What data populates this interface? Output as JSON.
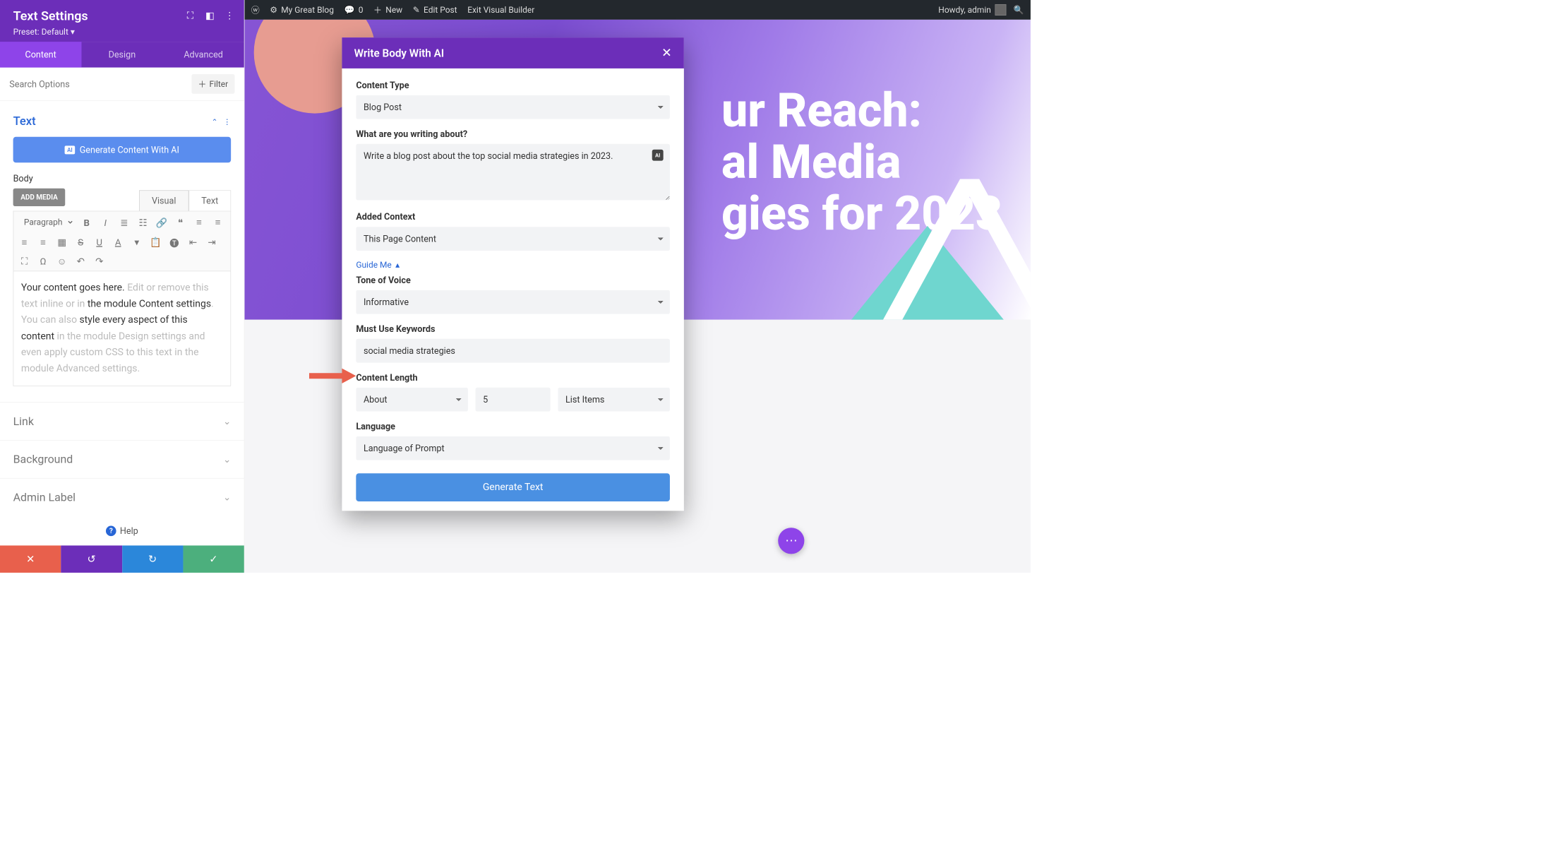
{
  "sidebar": {
    "title": "Text Settings",
    "preset": "Preset: Default",
    "tabs": [
      "Content",
      "Design",
      "Advanced"
    ],
    "active_tab": 0,
    "search_placeholder": "Search Options",
    "filter_label": "Filter",
    "section_title": "Text",
    "generate_btn": "Generate Content With AI",
    "body_label": "Body",
    "add_media": "ADD MEDIA",
    "editor_tabs": [
      "Visual",
      "Text"
    ],
    "active_editor_tab": 0,
    "paragraph_sel": "Paragraph",
    "editor_text_a": "Your content goes here.",
    "editor_text_b": " Edit or remove this text inline or in ",
    "editor_text_c": "the module Content settings",
    "editor_text_d": ". You can also ",
    "editor_text_e": "style every aspect of this content ",
    "editor_text_f": "in the module Design settings and even apply custom CSS to this text in the module Advanced settings.",
    "rows": [
      "Link",
      "Background",
      "Admin Label"
    ],
    "help": "Help"
  },
  "adminbar": {
    "site": "My Great Blog",
    "comments": "0",
    "new": "New",
    "edit": "Edit Post",
    "exit": "Exit Visual Builder",
    "howdy": "Howdy, admin"
  },
  "hero": {
    "line1": "ur Reach:",
    "line2": "al Media",
    "line3": "gies for 2023"
  },
  "modal": {
    "title": "Write Body With AI",
    "content_type_lbl": "Content Type",
    "content_type_val": "Blog Post",
    "about_lbl": "What are you writing about?",
    "about_val": "Write a blog post about the top social media strategies in 2023.",
    "context_lbl": "Added Context",
    "context_val": "This Page Content",
    "guide": "Guide Me",
    "tone_lbl": "Tone of Voice",
    "tone_val": "Informative",
    "keywords_lbl": "Must Use Keywords",
    "keywords_val": "social media strategies",
    "length_lbl": "Content Length",
    "length_prefix": "About",
    "length_num": "5",
    "length_unit": "List Items",
    "lang_lbl": "Language",
    "lang_val": "Language of Prompt",
    "generate": "Generate Text"
  }
}
